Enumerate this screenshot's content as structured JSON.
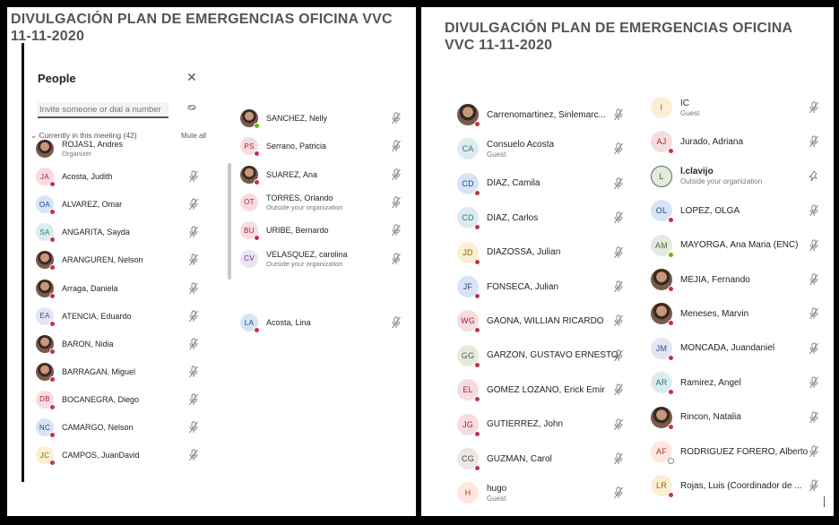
{
  "title": "DIVULGACIÓN PLAN DE EMERGENCIAS OFICINA VVC 11-11-2020",
  "people_pane": {
    "heading": "People",
    "close_icon": "close-icon",
    "invite_placeholder": "Invite someone or dial a number",
    "section_label": "Currently in this meeting (42)",
    "mute_all": "Mute all"
  },
  "colors": {
    "presence_busy": "#c4314b",
    "presence_available": "#6bb700"
  },
  "left_list": [
    {
      "name": "ROJAS1, Andres",
      "sub": "Organizer",
      "initials": "",
      "photo": true,
      "bg": "",
      "fg": "",
      "status": "none",
      "mic": false
    },
    {
      "name": "Acosta, Judith",
      "initials": "JA",
      "bg": "#f6dce0",
      "fg": "#a4262c",
      "status": "red",
      "mic": true
    },
    {
      "name": "ALVAREZ, Omar",
      "initials": "OA",
      "bg": "#d6e4f5",
      "fg": "#204b82",
      "status": "red",
      "mic": true
    },
    {
      "name": "ANGARITA, Sayda",
      "initials": "SA",
      "bg": "#dcecee",
      "fg": "#28787f",
      "status": "red",
      "mic": true
    },
    {
      "name": "ARANGUREN, Nelson",
      "initials": "",
      "photo": true,
      "status": "red",
      "mic": true
    },
    {
      "name": "Arraga, Daniela",
      "initials": "",
      "photo": true,
      "status": "red",
      "mic": true
    },
    {
      "name": "ATENCIA, Eduardo",
      "initials": "EA",
      "bg": "#e3e5f2",
      "fg": "#3b4b8a",
      "status": "red",
      "mic": true
    },
    {
      "name": "BARON, Nidia",
      "initials": "",
      "photo": true,
      "status": "red",
      "mic": true
    },
    {
      "name": "BARRAGAN, Miguel",
      "initials": "",
      "photo": true,
      "status": "red",
      "mic": true
    },
    {
      "name": "BOCANEGRA, Diego",
      "initials": "DB",
      "bg": "#f6dce0",
      "fg": "#a4262c",
      "status": "red",
      "mic": true
    },
    {
      "name": "CAMARGO, Nelson",
      "initials": "NC",
      "bg": "#d6e4f5",
      "fg": "#204b82",
      "status": "red",
      "mic": true
    },
    {
      "name": "CAMPOS, JuanDavid",
      "initials": "JC",
      "bg": "#fbefd3",
      "fg": "#8a6400",
      "status": "red",
      "mic": true
    }
  ],
  "middle_list": [
    {
      "name": "SANCHEZ, Nelly",
      "sub": "",
      "initials": "",
      "photo": true,
      "status": "green",
      "mic": true
    },
    {
      "name": "Serrano, Patricia",
      "sub": "",
      "initials": "PS",
      "bg": "#f6dce0",
      "fg": "#a4262c",
      "status": "red",
      "mic": true
    },
    {
      "name": "SUAREZ, Ana",
      "sub": "",
      "initials": "",
      "photo": true,
      "status": "red",
      "mic": true
    },
    {
      "name": "TORRES, Orlando",
      "sub": "Outside your organization",
      "initials": "OT",
      "bg": "#f6dce0",
      "fg": "#a4262c",
      "status": "none",
      "mic": true
    },
    {
      "name": "URIBE, Bernardo",
      "sub": "",
      "initials": "BU",
      "bg": "#f6dce0",
      "fg": "#a4262c",
      "status": "red",
      "mic": true
    },
    {
      "name": "VELASQUEZ, carolina",
      "sub": "Outside your organization",
      "initials": "CV",
      "bg": "#ece3f2",
      "fg": "#5c2e91",
      "status": "none",
      "mic": true
    },
    {
      "name": "Acosta, Lina",
      "sub": "",
      "initials": "LA",
      "bg": "#d6e4f5",
      "fg": "#204b82",
      "status": "red",
      "mic": true
    }
  ],
  "right_col1": [
    {
      "name": "Carrenomartinez, Sinlemarc...",
      "sub": "",
      "initials": "",
      "photo": true,
      "status": "red",
      "mic": true
    },
    {
      "name": "Consuelo Acosta",
      "sub": "Guest",
      "initials": "CA",
      "bg": "#dcecee",
      "fg": "#28787f",
      "status": "none",
      "mic": true
    },
    {
      "name": "DIAZ, Camila",
      "sub": "",
      "initials": "CD",
      "bg": "#d6e4f5",
      "fg": "#204b82",
      "status": "red",
      "mic": true
    },
    {
      "name": "DIAZ, Carlos",
      "sub": "",
      "initials": "CD",
      "bg": "#dcecee",
      "fg": "#28787f",
      "status": "red",
      "mic": true
    },
    {
      "name": "DIAZOSSA, Julian",
      "sub": "",
      "initials": "JD",
      "bg": "#fbefd3",
      "fg": "#8a6400",
      "status": "red",
      "mic": true
    },
    {
      "name": "FONSECA, Julian",
      "sub": "",
      "initials": "JF",
      "bg": "#d6e4f5",
      "fg": "#204b82",
      "status": "red",
      "mic": true
    },
    {
      "name": "GAONA, WILLIAN RICARDO",
      "sub": "",
      "initials": "WG",
      "bg": "#f6dce0",
      "fg": "#a4262c",
      "status": "red",
      "mic": true
    },
    {
      "name": "GARZON, GUSTAVO ERNESTO",
      "sub": "",
      "initials": "GG",
      "bg": "#e5eadf",
      "fg": "#4a6a2b",
      "status": "red",
      "mic": true
    },
    {
      "name": "GOMEZ LOZANO, Erick Emir",
      "sub": "",
      "initials": "EL",
      "bg": "#f6dce0",
      "fg": "#a4262c",
      "status": "red",
      "mic": true
    },
    {
      "name": "GUTIERREZ, John",
      "sub": "",
      "initials": "JG",
      "bg": "#f6dce0",
      "fg": "#a4262c",
      "status": "red",
      "mic": true
    },
    {
      "name": "GUZMAN, Carol",
      "sub": "",
      "initials": "CG",
      "bg": "#ebe7e4",
      "fg": "#5b4a3e",
      "status": "red",
      "mic": true
    },
    {
      "name": "hugo",
      "sub": "Guest",
      "initials": "H",
      "bg": "#fde7de",
      "fg": "#b5361d",
      "status": "none",
      "mic": true
    }
  ],
  "right_col2": [
    {
      "name": "IC",
      "sub": "Guest",
      "initials": "I",
      "bg": "#fbefd3",
      "fg": "#8a6400",
      "status": "none",
      "mic": true
    },
    {
      "name": "Jurado, Adriana",
      "sub": "",
      "initials": "AJ",
      "bg": "#f6dce0",
      "fg": "#a4262c",
      "status": "red",
      "mic": true
    },
    {
      "name": "l.clavijo",
      "sub": "Outside your organization",
      "initials": "L",
      "bg": "#e5eadf",
      "fg": "#4a6a2b",
      "status": "none",
      "bold": true,
      "mic": false
    },
    {
      "name": "LOPEZ, OLGA",
      "sub": "",
      "initials": "OL",
      "bg": "#d6e4f5",
      "fg": "#204b82",
      "status": "red",
      "mic": true
    },
    {
      "name": "MAYORGA, Ana Maria (ENC)",
      "sub": "",
      "initials": "AM",
      "bg": "#e5eadf",
      "fg": "#4a6a2b",
      "status": "green",
      "mic": true
    },
    {
      "name": "MEJIA, Fernando",
      "sub": "",
      "initials": "",
      "photo": true,
      "status": "red",
      "mic": true
    },
    {
      "name": "Meneses, Marvin",
      "sub": "",
      "initials": "",
      "photo": true,
      "status": "red",
      "mic": true
    },
    {
      "name": "MONCADA, Juandaniel",
      "sub": "",
      "initials": "JM",
      "bg": "#e3e5f2",
      "fg": "#3b4b8a",
      "status": "red",
      "mic": true
    },
    {
      "name": "Ramirez, Angel",
      "sub": "",
      "initials": "AR",
      "bg": "#dcecee",
      "fg": "#28787f",
      "status": "red",
      "mic": true
    },
    {
      "name": "Rincon, Natalia",
      "sub": "",
      "initials": "",
      "photo": true,
      "status": "red",
      "mic": true
    },
    {
      "name": "RODRIGUEZ FORERO, Alberto",
      "sub": "",
      "initials": "AF",
      "bg": "#fde7de",
      "fg": "#b5361d",
      "status": "away",
      "mic": true
    },
    {
      "name": "Rojas, Luis (Coordinador de ...",
      "sub": "",
      "initials": "LR",
      "bg": "#fbefd3",
      "fg": "#8a6400",
      "status": "red",
      "mic": true
    }
  ]
}
